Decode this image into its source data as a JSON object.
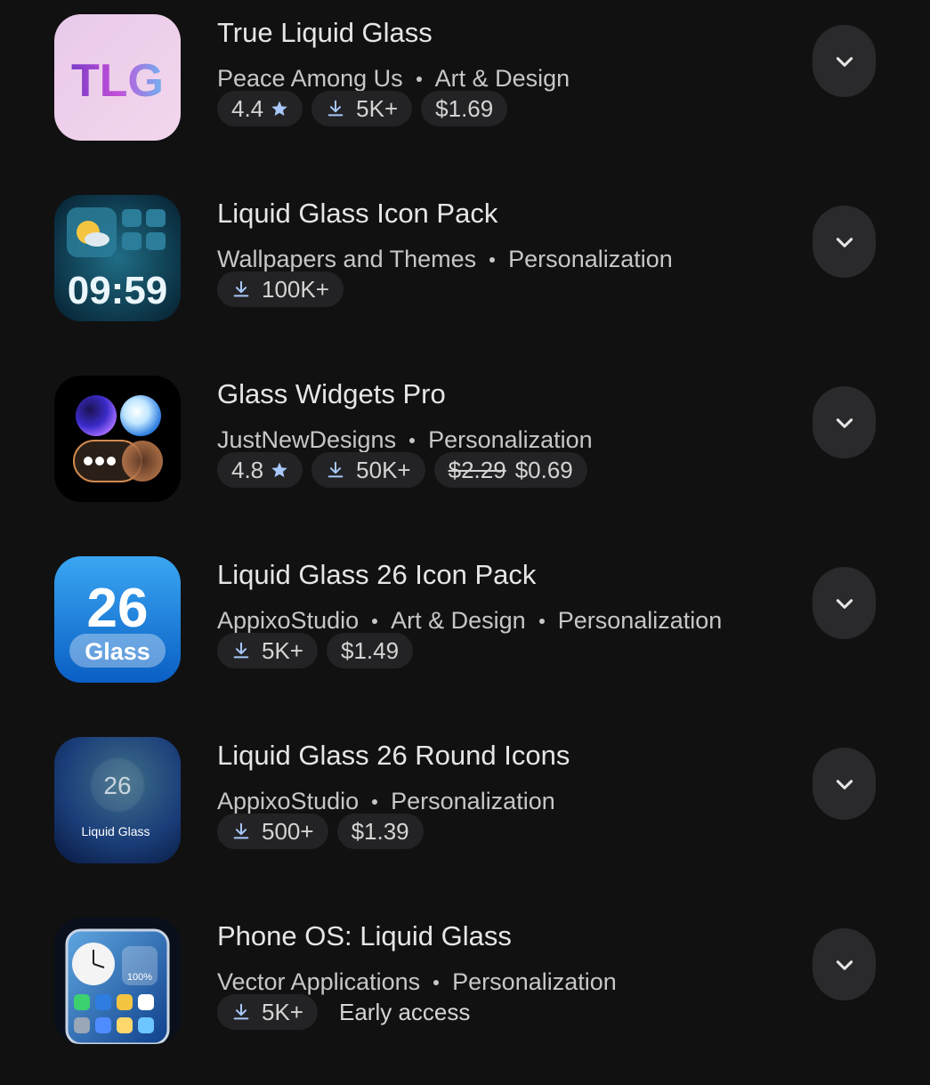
{
  "apps": [
    {
      "title": "True Liquid Glass",
      "developer": "Peace Among Us",
      "categories": [
        "Art & Design"
      ],
      "rating": "4.4",
      "downloads": "5K+",
      "price": "$1.69"
    },
    {
      "title": "Liquid Glass Icon Pack",
      "developer": "Wallpapers and Themes",
      "categories": [
        "Personalization"
      ],
      "downloads": "100K+",
      "icon_time": "09:59"
    },
    {
      "title": "Glass Widgets Pro",
      "developer": "JustNewDesigns",
      "categories": [
        "Personalization"
      ],
      "rating": "4.8",
      "downloads": "50K+",
      "original_price": "$2.29",
      "price": "$0.69"
    },
    {
      "title": "Liquid Glass 26 Icon Pack",
      "developer": "AppixoStudio",
      "categories": [
        "Art & Design",
        "Personalization"
      ],
      "downloads": "5K+",
      "price": "$1.49",
      "icon_number": "26",
      "icon_label": "Glass"
    },
    {
      "title": "Liquid Glass 26 Round Icons",
      "developer": "AppixoStudio",
      "categories": [
        "Personalization"
      ],
      "downloads": "500+",
      "price": "$1.39",
      "icon_number": "26",
      "icon_label": "Liquid Glass"
    },
    {
      "title": "Phone OS: Liquid Glass",
      "developer": "Vector Applications",
      "categories": [
        "Personalization"
      ],
      "downloads": "5K+",
      "status": "Early access",
      "icon_battery": "100%"
    }
  ],
  "colors": {
    "background": "#111112",
    "chip": "#232325",
    "expand_button": "#2a2a2c",
    "star": "#a8c7fa",
    "download": "#a8c7fa"
  },
  "icons": {
    "rating": "star-icon",
    "downloads": "download-icon",
    "expand": "chevron-down-icon"
  }
}
